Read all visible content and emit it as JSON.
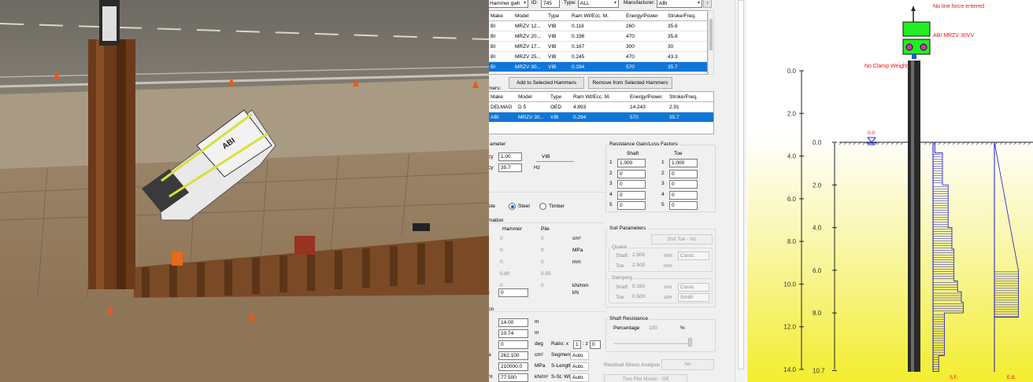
{
  "photo": {
    "machine_label": "ABI"
  },
  "toolbar": {
    "db_label": "Hammer gwh",
    "id_label": "ID:",
    "id_value": "745",
    "type_label": "Type:",
    "type_value": "ALL",
    "manufacturer_label": "Manufacturer:",
    "manufacturer_value": "ABI"
  },
  "hammer_table": {
    "columns": [
      "Make",
      "Model",
      "Type",
      "Ram Wt/Ecc. M.",
      "Energy/Power",
      "Stroke/Freq."
    ],
    "rows": [
      [
        "BI",
        "MRZV 12...",
        "VIB",
        "0.118",
        "260",
        "35.6"
      ],
      [
        "BI",
        "MRZV 20...",
        "VIB",
        "0.196",
        "470",
        "35.6"
      ],
      [
        "BI",
        "MRZV 17...",
        "VIB",
        "0.167",
        "300",
        "30"
      ],
      [
        "BI",
        "MRZV 25...",
        "VIB",
        "0.245",
        "470",
        "43.3"
      ],
      [
        "BI",
        "MRZV 30...",
        "VIB",
        "0.294",
        "570",
        "35.7"
      ]
    ],
    "selected_index": 4
  },
  "buttons": {
    "add": "Add to Selected Hammers",
    "remove": "Remove from Selected Hammers"
  },
  "selected_hammers": {
    "label": "mers:",
    "columns": [
      "Make",
      "Model",
      "Type",
      "Ram Wt/Ecc. M.",
      "Energy/Power",
      "Stroke/Freq."
    ],
    "rows": [
      [
        "DELMAG",
        "D 5",
        "OED",
        "4.893",
        "14.243",
        "2.91"
      ],
      [
        "ABI",
        "MRZV 30...",
        "VIB",
        "0.294",
        "570",
        "35.7"
      ]
    ],
    "selected_index": 1
  },
  "parameter": {
    "title": "ameter",
    "row1_label": "cy",
    "row1_value": "1.00",
    "row1_unit": "VIB",
    "row2_label": "cy",
    "row2_value": "35.7",
    "row2_unit": "Hz"
  },
  "material": {
    "prefix": "ete",
    "steel": "Steel",
    "timber": "Timber"
  },
  "information": {
    "title": "mation",
    "hammer_col": "Hammer",
    "pile_col": "Pile",
    "rows": [
      {
        "hammer": "0",
        "pile": "0",
        "unit": "cm²"
      },
      {
        "hammer": "0",
        "pile": "0",
        "unit": "MPa"
      },
      {
        "hammer": "0",
        "pile": "0",
        "unit": "mm"
      },
      {
        "hammer": "0.80",
        "pile": "0.50",
        "unit": ""
      },
      {
        "hammer": "0",
        "pile": "0",
        "unit": "kN/mm"
      }
    ],
    "last_label": "t",
    "last_value": "0",
    "last_unit": "kN"
  },
  "pile": {
    "title": "on",
    "rows": [
      {
        "value": "14.00",
        "unit": "m",
        "extra_label": "",
        "extra_value": ""
      },
      {
        "value": "10.74",
        "unit": "m",
        "extra_label": "",
        "extra_value": ""
      },
      {
        "value": "0",
        "unit": "deg",
        "extra_label": "Ratio: x",
        "extra_value": "1",
        "extra_label2": ": z",
        "extra_value2": "0"
      },
      {
        "value": "262.100",
        "unit": "cm²",
        "extra_label": "Segments",
        "extra_value": "Auto",
        "prefix": "a"
      },
      {
        "value": "210000.0",
        "unit": "MPa",
        "extra_label": "S-Length",
        "extra_value": "Auto."
      },
      {
        "value": "77.500",
        "unit": "kN/m³",
        "extra_label": "S-St. Wt",
        "extra_value": "Auto.",
        "prefix": "ht"
      }
    ]
  },
  "resistance": {
    "title": "Resistance Gain/Loss Factors",
    "shaft": "Shaft",
    "toe": "Toe",
    "rows": [
      {
        "n": "1",
        "shaft": "1.000",
        "toe": "1.000"
      },
      {
        "n": "2",
        "shaft": "0",
        "toe": "0"
      },
      {
        "n": "3",
        "shaft": "0",
        "toe": "0"
      },
      {
        "n": "4",
        "shaft": "0",
        "toe": "0"
      },
      {
        "n": "5",
        "shaft": "0",
        "toe": "0"
      }
    ]
  },
  "soil": {
    "title": "Soil Parameters",
    "toe_button": "2nd Toe - No",
    "quake": "Quake",
    "quake_shaft_label": "Shaft",
    "quake_shaft": "2.500",
    "quake_shaft_unit": "mm",
    "quake_shaft_mode": "Const.",
    "quake_toe_label": "Toe",
    "quake_toe": "2.500",
    "quake_toe_unit": "mm",
    "damping": "Damping",
    "damp_shaft_label": "Shaft",
    "damp_shaft": "0.160",
    "damp_shaft_unit": "s/m",
    "damp_shaft_mode": "Const.",
    "damp_toe_label": "Toe",
    "damp_toe": "0.500",
    "damp_toe_unit": "s/m",
    "damp_toe_mode": "Smith"
  },
  "shaft_resistance": {
    "title": "Shaft Resistance",
    "label": "Percentage",
    "value": "100",
    "unit": "%",
    "slider_fraction": 1.0
  },
  "residual": {
    "label": "Residual Stress Analysis",
    "value": "No"
  },
  "two_pile": {
    "label": "Two Pile Model - Off"
  },
  "graph": {
    "no_line_force": "No line force entered",
    "hammer_name": "ABI MRZV 30VV",
    "no_clamp": "No Clamp Weight",
    "water_level": "0.0",
    "left_axis": [
      "0.0",
      "2.0",
      "4.0",
      "6.0",
      "8.0",
      "10.0",
      "12.0",
      "14.0"
    ],
    "right_axis": [
      "0.0",
      "2.0",
      "4.0",
      "6.0",
      "8.0",
      "10.7"
    ],
    "sf_label": "S.F.",
    "eb_label": "E.B.",
    "pile_length": 14.0,
    "penetration": 10.74,
    "shaft_profile": [
      {
        "from": 0.0,
        "to": 0.5,
        "w": 1
      },
      {
        "from": 0.5,
        "to": 2.0,
        "w": 5
      },
      {
        "from": 2.0,
        "to": 4.0,
        "w": 8
      },
      {
        "from": 4.0,
        "to": 5.0,
        "w": 10
      },
      {
        "from": 5.0,
        "to": 6.5,
        "w": 11
      },
      {
        "from": 6.5,
        "to": 7.0,
        "w": 13
      },
      {
        "from": 7.0,
        "to": 7.5,
        "w": 15
      },
      {
        "from": 7.5,
        "to": 8.0,
        "w": 16
      },
      {
        "from": 8.0,
        "to": 10.0,
        "w": 6
      },
      {
        "from": 10.0,
        "to": 10.74,
        "w": 3
      }
    ],
    "end_bearing": {
      "from": 6.0,
      "to": 8.2,
      "w": 16
    }
  },
  "colors": {
    "selection": "#0f76d8",
    "hammer_green": "#22ee22",
    "hammer_magenta": "#ee22cc",
    "label_red": "#ee1111",
    "profile_blue": "#1818c8"
  }
}
